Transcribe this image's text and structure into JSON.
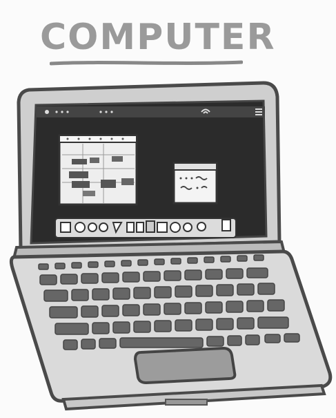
{
  "illustration": {
    "title": "COMPUTER",
    "subject": "laptop-icon",
    "colors": {
      "outline": "#4a4a4a",
      "screen": "#2b2b2b",
      "body": "#d9d9d9",
      "keys": "#666666",
      "title_gray": "#9a9a9a"
    }
  }
}
